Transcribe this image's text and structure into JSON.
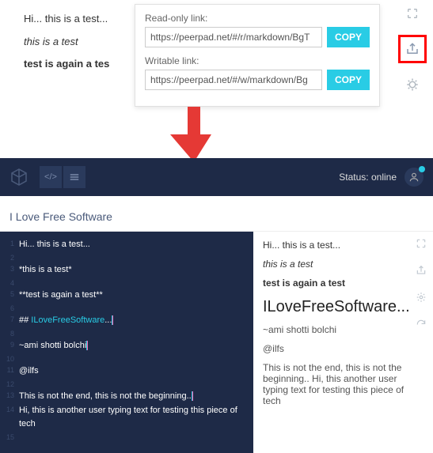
{
  "top_preview": {
    "line1": "Hi... this is a test...",
    "line2": "this is a test",
    "line3": "test is again a tes"
  },
  "share": {
    "readonly_label": "Read-only link:",
    "readonly_value": "https://peerpad.net/#/r/markdown/BgT",
    "writable_label": "Writable link:",
    "writable_value": "https://peerpad.net/#/w/markdown/Bg",
    "copy_label": "COPY"
  },
  "header": {
    "status": "Status: online"
  },
  "doc_title": "I Love Free Software",
  "editor": {
    "lines": [
      "Hi... this is a test...",
      "",
      "*this is a test*",
      "",
      "**test is again a test**",
      "",
      "## ILoveFreeSoftware...",
      "",
      "~ami shotti bolchi",
      "",
      "@ilfs",
      "",
      "This is not the end, this is not the beginning..",
      "Hi, this is another user typing text for testing this piece of tech",
      ""
    ]
  },
  "rendered": {
    "p1": "Hi... this is a test...",
    "p2": "this is a test",
    "p3": "test is again a test",
    "h2": "ILoveFreeSoftware...",
    "p4": "~ami shotti bolchi",
    "p5": "@ilfs",
    "p6": "This is not the end, this is not the beginning.. Hi, this another user typing text for testing this piece of tech"
  }
}
